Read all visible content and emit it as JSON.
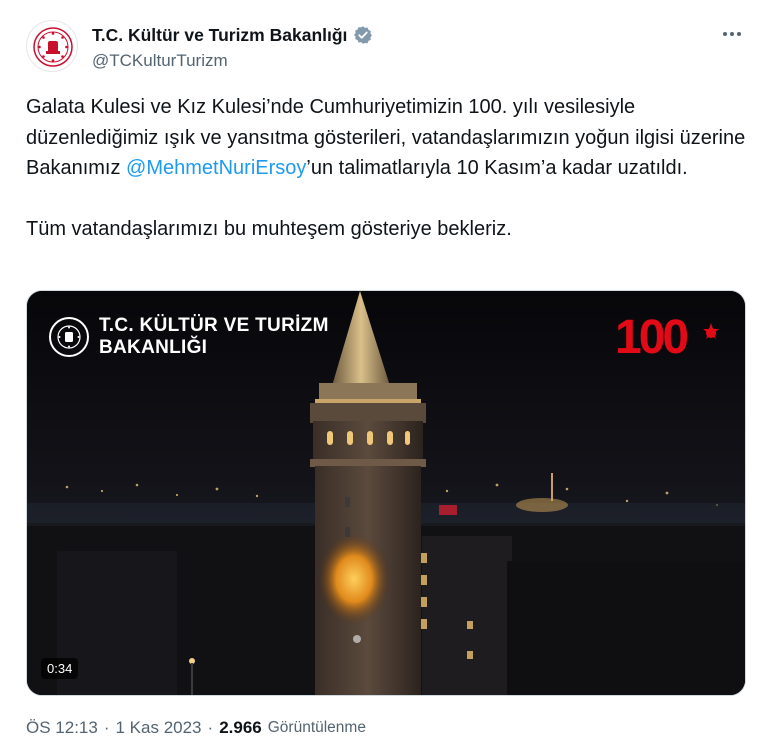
{
  "account": {
    "display_name": "T.C. Kültür ve Turizm Bakanlığı",
    "handle": "@TCKulturTurizm",
    "avatar_icon": "ministry-emblem-icon",
    "verified_icon": "verified-badge-icon",
    "verified_color": "#829aab"
  },
  "tweet": {
    "text_before_mention": "Galata Kulesi ve Kız Kulesi’nde Cumhuriyetimizin 100. yılı vesilesiyle düzenlediğimiz ışık ve yansıtma gösterileri, vatandaşlarımızın yoğun ilgisi üzerine Bakanımız ",
    "mention": "@MehmetNuriErsoy",
    "text_after_mention": "’un talimatlarıyla 10 Kasım’a kadar uzatıldı.",
    "paragraph_2": "Tüm vatandaşlarımızı bu muhteşem gösteriye bekleriz."
  },
  "media": {
    "type": "video",
    "brand_line_1": "T.C. KÜLTÜR VE TURİZM",
    "brand_line_2": "BAKANLIĞI",
    "badge_text": "100",
    "duration": "0:34"
  },
  "meta": {
    "time": "ÖS 12:13",
    "separator": "·",
    "date": "1 Kas 2023",
    "views_count": "2.966",
    "views_label": "Görüntülenme"
  },
  "colors": {
    "mention": "#1d9bf0",
    "secondary_text": "#536471",
    "brand_red": "#e30a17"
  }
}
